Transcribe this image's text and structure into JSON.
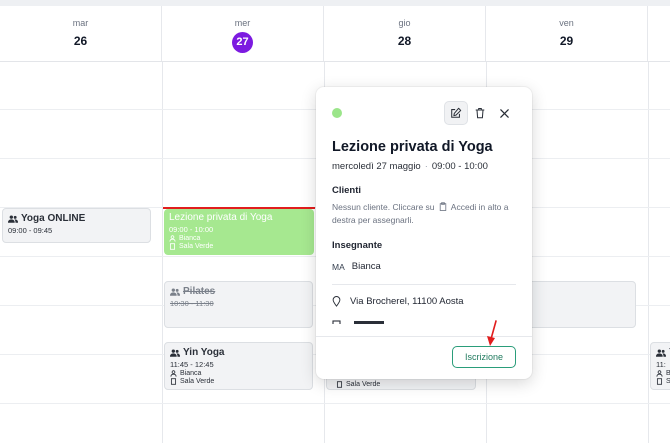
{
  "days": [
    {
      "dow": "mar",
      "num": "26",
      "today": false
    },
    {
      "dow": "mer",
      "num": "27",
      "today": true
    },
    {
      "dow": "gio",
      "num": "28",
      "today": false
    },
    {
      "dow": "ven",
      "num": "29",
      "today": false
    }
  ],
  "events": {
    "yoga_online": {
      "title": "Yoga ONLINE",
      "time": "09:00 - 09:45"
    },
    "lezione_privata": {
      "title": "Lezione privata di Yoga",
      "time": "09:00 - 10:00",
      "teacher": "Bianca",
      "room": "Sala Verde"
    },
    "pilates": {
      "title": "Pilates",
      "time": "10:30 - 11:30"
    },
    "yin_yoga": {
      "title": "Yin Yoga",
      "time": "11:45 - 12:45",
      "teacher": "Bianca",
      "room": "Sala Verde"
    },
    "gio_room": "Sala Verde",
    "right_edge": {
      "title": "Yi",
      "time": "11:",
      "teacher": "B",
      "room": "S"
    }
  },
  "popover": {
    "title": "Lezione privata di Yoga",
    "date": "mercoledì 27 maggio",
    "time": "09:00 - 10:00",
    "clients_label": "Clienti",
    "clients_text": "Nessun cliente. Cliccare su",
    "clients_text2": "Accedi in alto a destra per assegnarli.",
    "teacher_label": "Insegnante",
    "teacher_initials": "MA",
    "teacher_name": "Bianca",
    "address": "Via Brocherel, 11100 Aosta",
    "button_label": "Iscrizione"
  },
  "colors": {
    "today": "#7c1ae0",
    "green_event": "#a6e890",
    "now_line": "#e11d1d",
    "button_border": "#2a9d7a"
  },
  "icons": [
    "group-icon",
    "person-icon",
    "room-icon",
    "edit-icon",
    "trash-icon",
    "close-icon",
    "clipboard-icon",
    "map-pin-icon"
  ]
}
